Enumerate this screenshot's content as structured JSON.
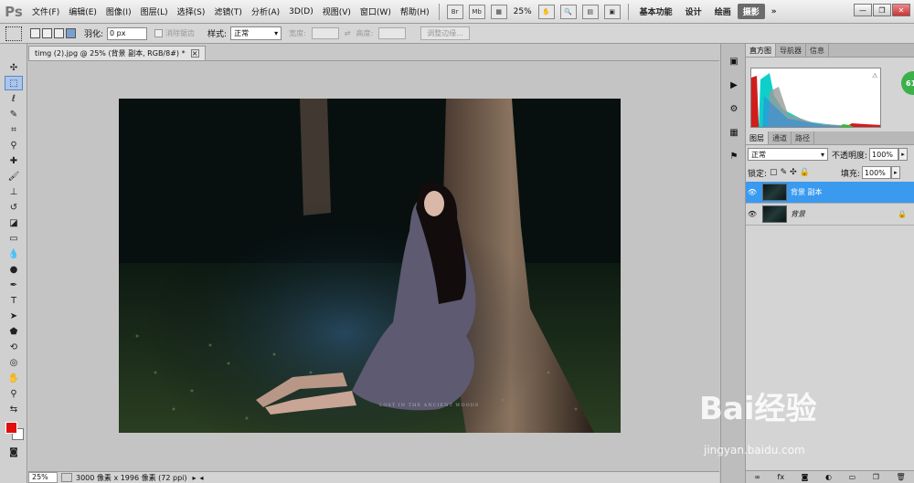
{
  "app": {
    "logo": "Ps"
  },
  "menu": [
    "文件(F)",
    "编辑(E)",
    "图像(I)",
    "图层(L)",
    "选择(S)",
    "滤镜(T)",
    "分析(A)",
    "3D(D)",
    "视图(V)",
    "窗口(W)",
    "帮助(H)"
  ],
  "menubar_icons": {
    "br": "Br",
    "mb": "Mb"
  },
  "zoom_menu": "25%",
  "workspaces": [
    "基本功能",
    "设计",
    "绘画",
    "摄影"
  ],
  "workspace_active": "摄影",
  "options": {
    "feather_label": "羽化:",
    "feather_value": "0 px",
    "antialias_label": "消除锯齿",
    "style_label": "样式:",
    "style_value": "正常",
    "width_label": "宽度:",
    "height_label": "高度:",
    "refine_button": "调整边缘..."
  },
  "document": {
    "tab_title": "timg (2).jpg @ 25% (背景 副本, RGB/8#) *",
    "close": "×"
  },
  "photo": {
    "caption": "LOST IN THE ANCIENT WOODS"
  },
  "status": {
    "zoom": "25%",
    "size": "3000 像素 x 1996 像素 (72 ppi)"
  },
  "panels": {
    "top_tabs": [
      "直方图",
      "导航器",
      "信息"
    ],
    "layer_tabs": [
      "图层",
      "通道",
      "路径"
    ],
    "blend_mode": "正常",
    "opacity_label": "不透明度:",
    "opacity_value": "100%",
    "lock_label": "锁定:",
    "fill_label": "填充:",
    "fill_value": "100%",
    "layers": [
      {
        "name": "背景 副本",
        "selected": true
      },
      {
        "name": "背景",
        "selected": false
      }
    ],
    "footer_icons": [
      "链接",
      "fx",
      "蒙版",
      "调整",
      "组",
      "新建",
      "删除"
    ]
  },
  "badge": "61",
  "watermark": {
    "brand": "Bai经验",
    "url": "jingyan.baidu.com"
  },
  "colors": {
    "foreground": "#e01010",
    "background": "#ffffff",
    "selection": "#3a9af0"
  }
}
